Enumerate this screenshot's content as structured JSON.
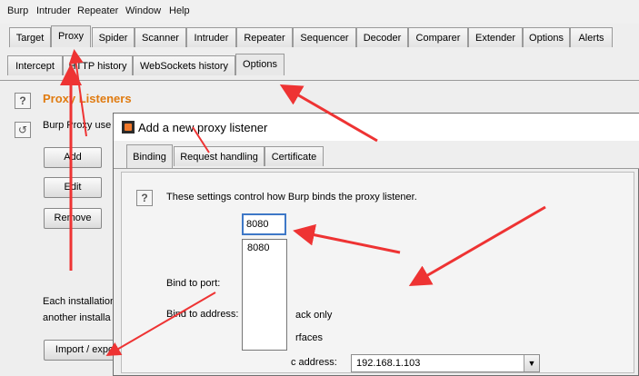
{
  "menubar": {
    "items": [
      "Burp",
      "Intruder",
      "Repeater",
      "Window",
      "Help"
    ]
  },
  "main_tabs": [
    "Target",
    "Proxy",
    "Spider",
    "Scanner",
    "Intruder",
    "Repeater",
    "Sequencer",
    "Decoder",
    "Comparer",
    "Extender",
    "Options",
    "Alerts"
  ],
  "sub_tabs": [
    "Intercept",
    "HTTP history",
    "WebSockets history",
    "Options"
  ],
  "proxy_listeners": {
    "title": "Proxy Listeners",
    "desc": "Burp Proxy use",
    "help_symbol": "?",
    "refresh_symbol": "↺",
    "add_label": "Add",
    "edit_label": "Edit",
    "remove_label": "Remove",
    "note_line1": "Each installation",
    "note_line2": "another installa",
    "import_label": "Import / expo"
  },
  "dialog": {
    "title": "Add a new proxy listener",
    "tabs": [
      "Binding",
      "Request handling",
      "Certificate"
    ],
    "help_symbol": "?",
    "description": "These settings control how Burp binds the proxy listener.",
    "bind_port_label": "Bind to port:",
    "bind_port_value": "8080",
    "dropdown_option": "8080",
    "bind_address_label": "Bind to address:",
    "loopback_fragment": "ack only",
    "interfaces_fragment": "rfaces",
    "specific_fragment": "c address:",
    "specific_address_value": "192.168.1.103",
    "select_arrow": "▼"
  },
  "colors": {
    "title_orange": "#e07b10",
    "annotation_red": "#ee3333",
    "focus_blue": "#3e78c7"
  }
}
